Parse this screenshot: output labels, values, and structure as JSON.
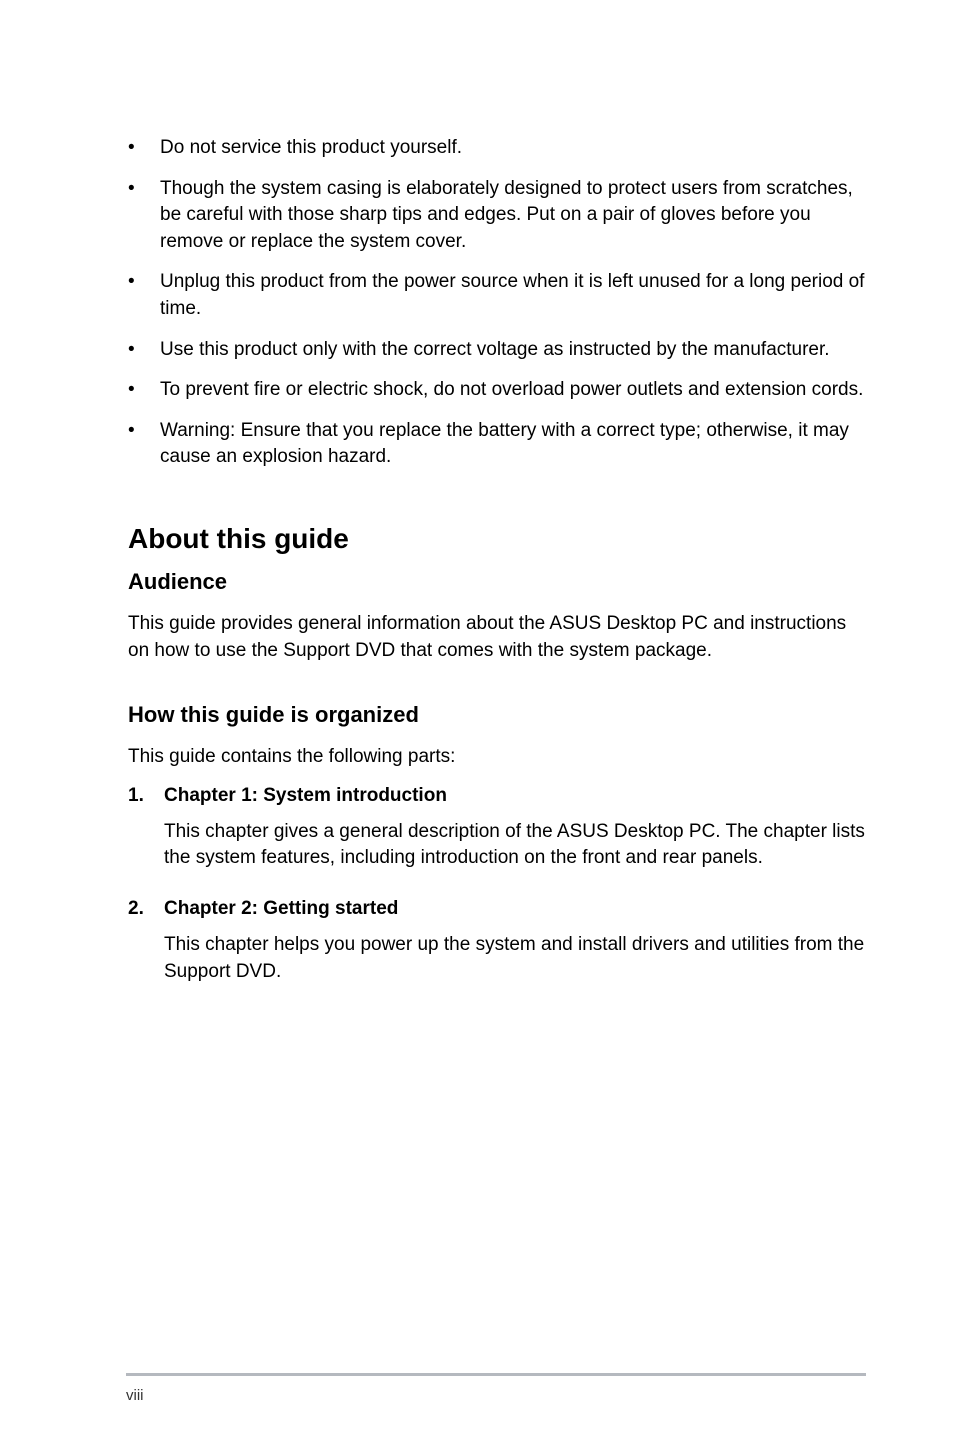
{
  "bullets": [
    "Do not service this product yourself.",
    "Though the system casing is elaborately designed to protect users from scratches, be careful with those sharp tips and edges. Put on a pair of gloves before you remove or replace the system cover.",
    "Unplug this product from the power source when it is left unused for a long period of time.",
    "Use this product only with the correct voltage as instructed by the manufacturer.",
    "To prevent fire or electric shock, do not overload power outlets and extension cords.",
    "Warning: Ensure that you replace the battery with a correct type; otherwise, it may cause an explosion hazard."
  ],
  "heading_main": "About this guide",
  "section1": {
    "heading": "Audience",
    "text": "This guide provides general information about the ASUS Desktop PC and instructions on how to use the Support DVD that comes with the system package."
  },
  "section2": {
    "heading": "How this guide is organized",
    "intro": "This guide contains the following parts:",
    "items": [
      {
        "num": "1.",
        "title": "Chapter 1: System introduction",
        "desc": "This chapter gives a general description of the ASUS Desktop PC. The chapter lists the system features, including introduction on the front and rear panels."
      },
      {
        "num": "2.",
        "title": "Chapter 2: Getting started",
        "desc": "This chapter helps you power up the system and install drivers and utilities from the Support DVD."
      }
    ]
  },
  "page_number": "viii"
}
